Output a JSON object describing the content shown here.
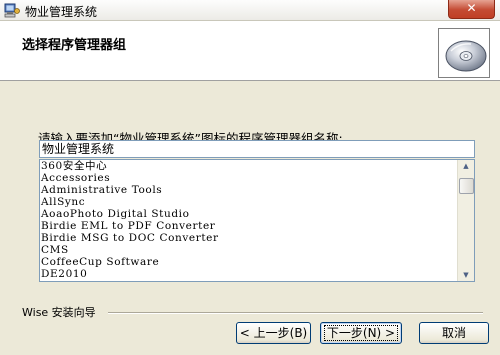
{
  "window": {
    "title": "物业管理系统",
    "close_glyph": "✕"
  },
  "header": {
    "title": "选择程序管理器组"
  },
  "prompt": "请输入要添加“物业管理系统”图标的程序管理器组名称:",
  "group_input": {
    "value": "物业管理系统"
  },
  "program_groups": [
    "360安全中心",
    "Accessories",
    "Administrative Tools",
    "AllSync",
    "AoaoPhoto Digital Studio",
    "Birdie EML to PDF Converter",
    "Birdie MSG to DOC Converter",
    "CMS",
    "CoffeeCup Software",
    "DE2010"
  ],
  "footer": {
    "group_label": "Wise 安装向导",
    "back_label": "< 上一步(B)",
    "next_label": "下一步(N) >",
    "cancel_label": "取消"
  },
  "colors": {
    "close_button": "#c44b33",
    "button_border": "#003c74"
  },
  "icons": {
    "app": "installer-computer-icon",
    "header": "cd-disc-icon",
    "close": "close-icon"
  }
}
